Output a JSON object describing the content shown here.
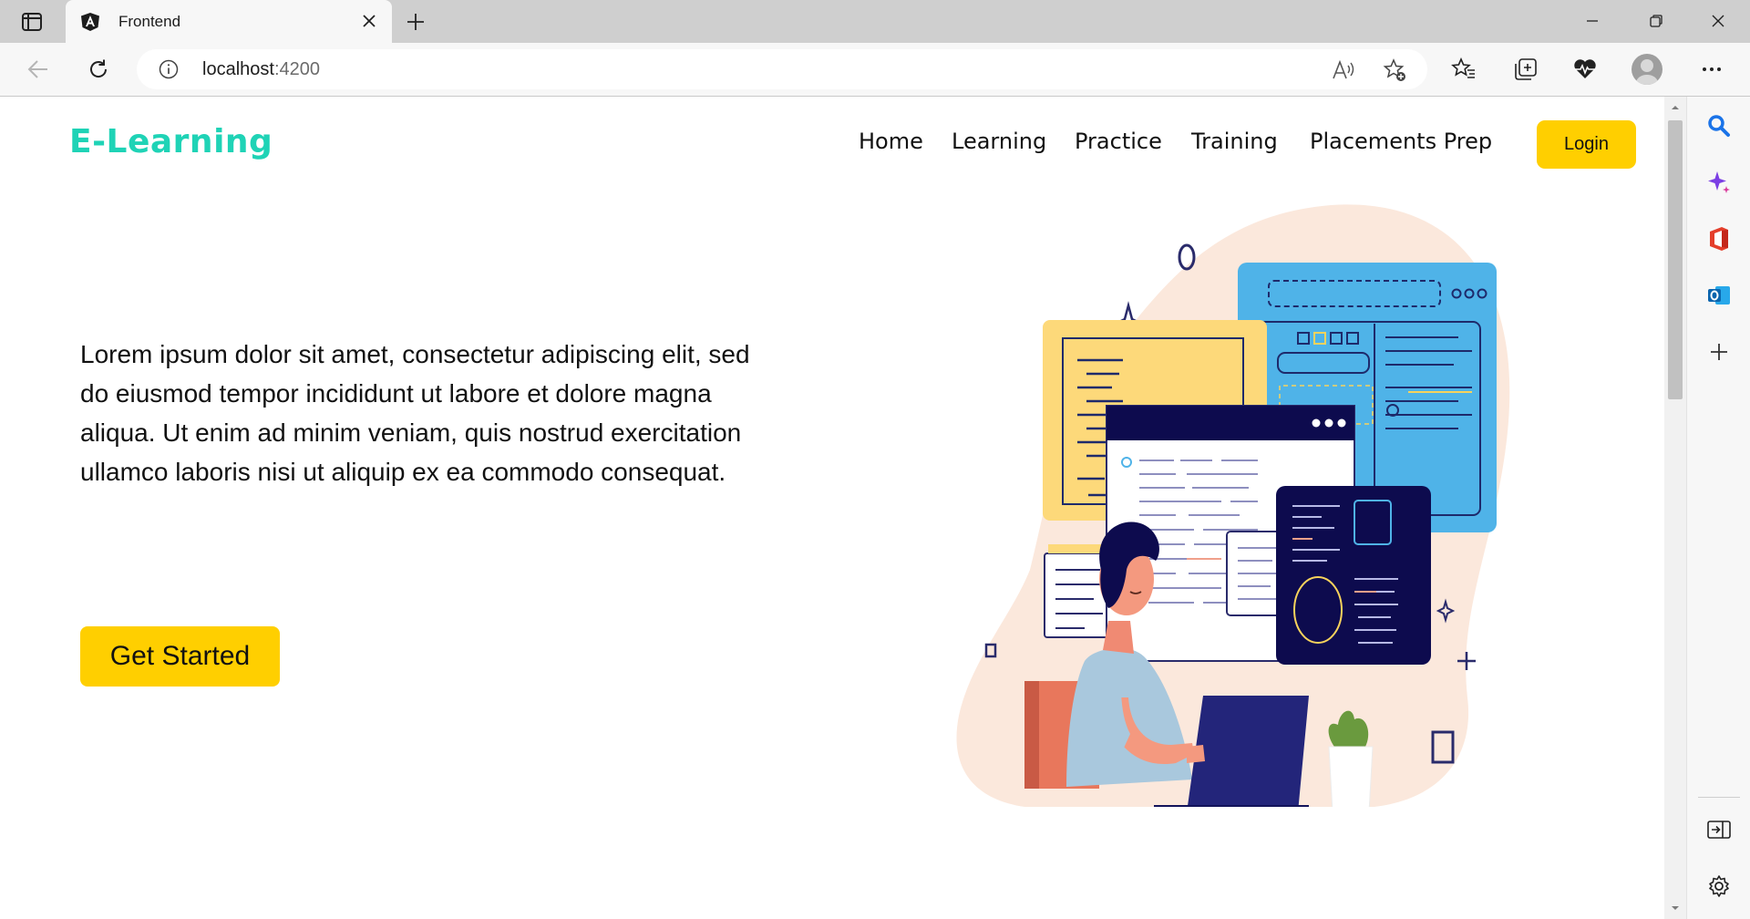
{
  "browser": {
    "tab_title": "Frontend",
    "url_host": "localhost",
    "url_port": ":4200"
  },
  "icons": {
    "tab_actions": "tab-actions-icon",
    "angular": "angular-icon",
    "close": "close-icon",
    "new_tab": "plus-icon",
    "minimize": "minimize-icon",
    "restore": "restore-icon",
    "back": "back-arrow-icon",
    "refresh": "refresh-icon",
    "site_info": "info-icon",
    "read_aloud": "read-aloud-icon",
    "add_favorite": "star-plus-icon",
    "favorites": "favorites-icon",
    "collections": "collections-icon",
    "health": "heart-pulse-icon",
    "profile": "profile-icon",
    "more": "more-icon",
    "search": "search-icon",
    "copilot": "sparkle-icon",
    "office": "office-icon",
    "outlook": "outlook-icon",
    "add": "plus-icon",
    "sidebar_toggle": "sidebar-icon",
    "settings": "gear-icon"
  },
  "site": {
    "logo": "E-Learning",
    "nav": [
      "Home",
      "Learning",
      "Practice",
      "Training",
      "Placements Prep"
    ],
    "login_label": "Login",
    "hero_text": "Lorem ipsum dolor sit amet, consectetur adipiscing elit, sed do eiusmod tempor incididunt ut labore et dolore magna aliqua. Ut enim ad minim veniam, quis nostrud exercitation ullamco laboris nisi ut aliquip ex ea commodo consequat.",
    "cta_label": "Get Started"
  },
  "colors": {
    "brand": "#1fd3b6",
    "accent": "#ffcf00"
  }
}
